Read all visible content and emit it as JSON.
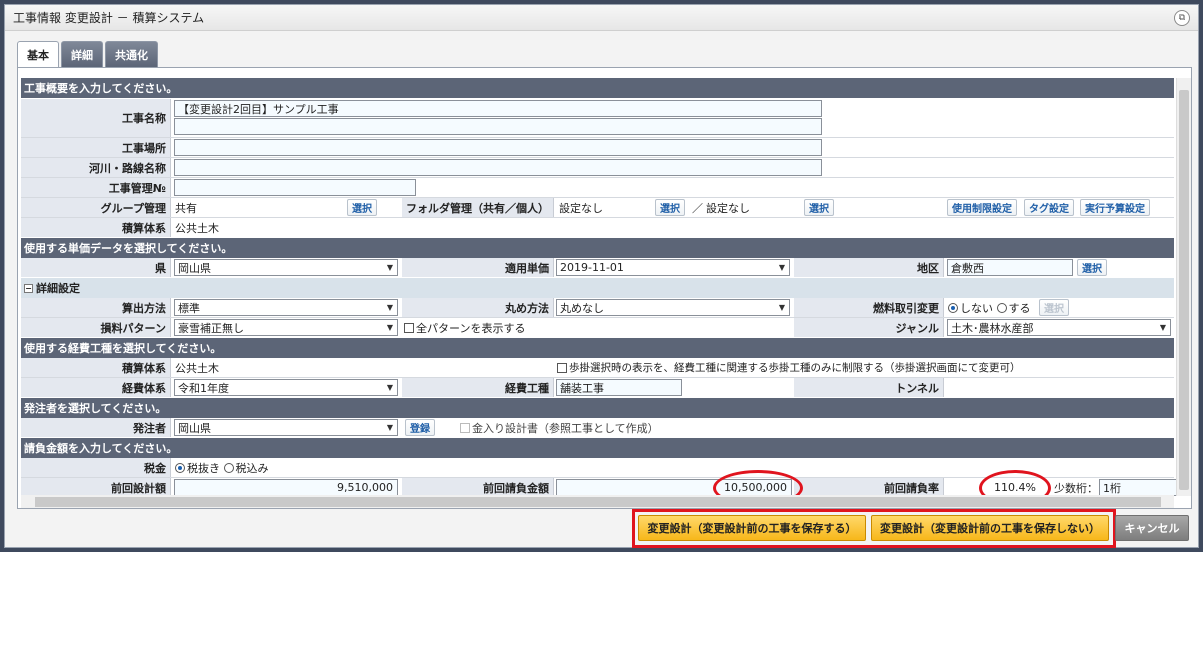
{
  "window": {
    "title": "工事情報 変更設計 － 積算システム"
  },
  "tabs": [
    {
      "label": "基本"
    },
    {
      "label": "詳細"
    },
    {
      "label": "共通化"
    }
  ],
  "sections": {
    "overview": "工事概要を入力してください。",
    "unit_price": "使用する単価データを選択してください。",
    "detail": "詳細設定",
    "expense": "使用する経費工種を選択してください。",
    "orderer": "発注者を選択してください。",
    "contract": "請負金額を入力してください。"
  },
  "overview": {
    "name_label": "工事名称",
    "name_value": "【変更設計2回目】サンプル工事",
    "name_value2": "",
    "place_label": "工事場所",
    "place_value": "",
    "river_label": "河川・路線名称",
    "river_value": "",
    "mgmt_no_label": "工事管理№",
    "mgmt_no_value": "",
    "group_label": "グループ管理",
    "group_value": "共有",
    "select_label": "選択",
    "folder_label": "フォルダ管理（共有／個人）",
    "folder_value1": "設定なし",
    "folder_sep": "／",
    "folder_value2": "設定なし",
    "usage_limit_label": "使用制限設定",
    "tag_label": "タグ設定",
    "budget_label": "実行予算設定",
    "system_label": "積算体系",
    "system_value": "公共土木"
  },
  "unit_price": {
    "pref_label": "県",
    "pref_value": "岡山県",
    "applied_label": "適用単価",
    "applied_value": "2019-11-01",
    "area_label": "地区",
    "area_value": "倉敷西",
    "select_label": "選択"
  },
  "detail": {
    "calc_label": "算出方法",
    "calc_value": "標準",
    "round_label": "丸め方法",
    "round_value": "丸めなし",
    "fuel_label": "燃料取引変更",
    "fuel_opt1": "しない",
    "fuel_opt2": "する",
    "fuel_select": "選択",
    "loss_label": "損料パターン",
    "loss_value": "豪雪補正無し",
    "show_all_label": "全パターンを表示する",
    "genre_label": "ジャンル",
    "genre_value": "土木･農林水産部"
  },
  "expense": {
    "system_label": "積算体系",
    "system_value": "公共土木",
    "restrict_label": "歩掛選択時の表示を、経費工種に関連する歩掛工種のみに制限する（歩掛選択画面にて変更可）",
    "expense_system_label": "経費体系",
    "expense_system_value": "令和1年度",
    "expense_type_label": "経費工種",
    "expense_type_value": "舗装工事",
    "tunnel_label": "トンネル"
  },
  "orderer": {
    "label": "発注者",
    "value": "岡山県",
    "register_label": "登録",
    "priced_label": "金入り設計書（参照工事として作成）"
  },
  "contract": {
    "tax_label": "税金",
    "tax_opt1": "税抜き",
    "tax_opt2": "税込み",
    "prev_design_label": "前回設計額",
    "prev_design_value": "9,510,000",
    "prev_contract_label": "前回請負金額",
    "prev_contract_value": "10,500,000",
    "prev_rate_label": "前回請負率",
    "prev_rate_value": "110.4%",
    "decimal_label": "少数桁：",
    "decimal_value": "1桁"
  },
  "footer": {
    "save_btn": "変更設計（変更設計前の工事を保存する）",
    "nosave_btn": "変更設計（変更設計前の工事を保存しない）",
    "cancel_btn": "キャンセル"
  },
  "colors": {
    "section_bg": "#5c6577",
    "highlight": "#e0141e",
    "primary_btn": "#f7b71a"
  }
}
